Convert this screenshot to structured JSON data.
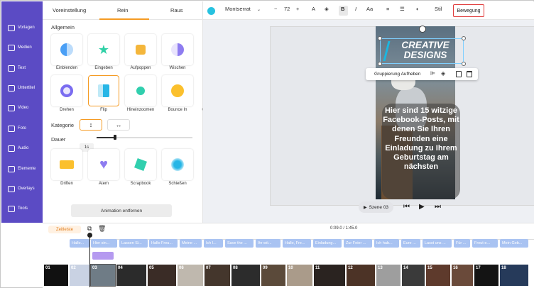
{
  "nav": {
    "items": [
      {
        "label": "Vorlagen",
        "icon": "template-icon"
      },
      {
        "label": "Medien",
        "icon": "media-icon"
      },
      {
        "label": "Text",
        "icon": "text-icon"
      },
      {
        "label": "Untertitel",
        "icon": "subtitle-icon"
      },
      {
        "label": "Video",
        "icon": "video-icon"
      },
      {
        "label": "Foto",
        "icon": "photo-icon"
      },
      {
        "label": "Audio",
        "icon": "audio-icon"
      },
      {
        "label": "Elemente",
        "icon": "elements-icon"
      },
      {
        "label": "Overlays",
        "icon": "overlays-icon"
      },
      {
        "label": "Tools",
        "icon": "tools-icon"
      }
    ]
  },
  "panel": {
    "tabs": [
      "Voreinstellung",
      "Rein",
      "Raus"
    ],
    "active_tab": "Rein",
    "general_title": "Allgemein",
    "animations": [
      {
        "label": "Einblenden",
        "color": "#4a9ff5"
      },
      {
        "label": "Eingeben",
        "color": "#2fd0a6"
      },
      {
        "label": "Aufpoppen",
        "color": "#f4b63b"
      },
      {
        "label": "Wischen",
        "color": "#8e7cf0"
      },
      {
        "label": "Drehen",
        "color": "#7a6cf0"
      },
      {
        "label": "Flip",
        "color": "#27b6e6"
      },
      {
        "label": "Hineinzoomen",
        "color": "#31cfae"
      },
      {
        "label": "Bounce In",
        "color": "#fbc02d"
      },
      {
        "label": "Driften",
        "color": "#fbc02d"
      },
      {
        "label": "Atem",
        "color": "#8e7cf0"
      },
      {
        "label": "Scrapbook",
        "color": "#31cfae"
      },
      {
        "label": "Schießen",
        "color": "#27b6e6"
      }
    ],
    "selected_animation": "Flip",
    "kategorie_label": "Kategorie",
    "kategorie_vertical": "↕",
    "kategorie_horizontal": "↔",
    "dauer_label": "Dauer",
    "dauer_value": "1s",
    "remove_button": "Animation entfernen"
  },
  "toolbar": {
    "text_color": "#27c2e0",
    "font_name": "Montserrat",
    "minus": "−",
    "font_size": "72",
    "plus": "+",
    "font_icon": "A",
    "bold": "B",
    "italic": "I",
    "case": "Aa",
    "stil": "Stil",
    "bewegung": "Bewegung"
  },
  "canvas": {
    "headline": "CREATIVE DESIGNS",
    "body_text": "Hier sind 15 witzige Facebook-Posts, mit denen Sie Ihren Freunden eine Einladung zu Ihrem Geburtstag am nächsten",
    "context_menu_label": "Gruppierung Aufheben",
    "scene_label": "Szene 03"
  },
  "timeline": {
    "zeitleiste": "Zeitleiste",
    "time": "0:09.0 / 1:45.0",
    "text_chips": [
      "Hallo...",
      "Hier sin...",
      "Lassen Si...",
      "Hallo Freu...",
      "Meine ...",
      "Ich l...",
      "Save the ...",
      "Ihr wö...",
      "Hallo, Fre...",
      "Einladung...",
      "Zur Feier ...",
      "Ich hab...",
      "Eure ...",
      "Lasst uns ...",
      "Für ...",
      "Freut e...",
      "Mein Geb..."
    ],
    "scenes": [
      "01",
      "02",
      "03",
      "04",
      "05",
      "06",
      "07",
      "08",
      "09",
      "10",
      "11",
      "12",
      "13",
      "14",
      "15",
      "16",
      "17",
      "18"
    ]
  }
}
